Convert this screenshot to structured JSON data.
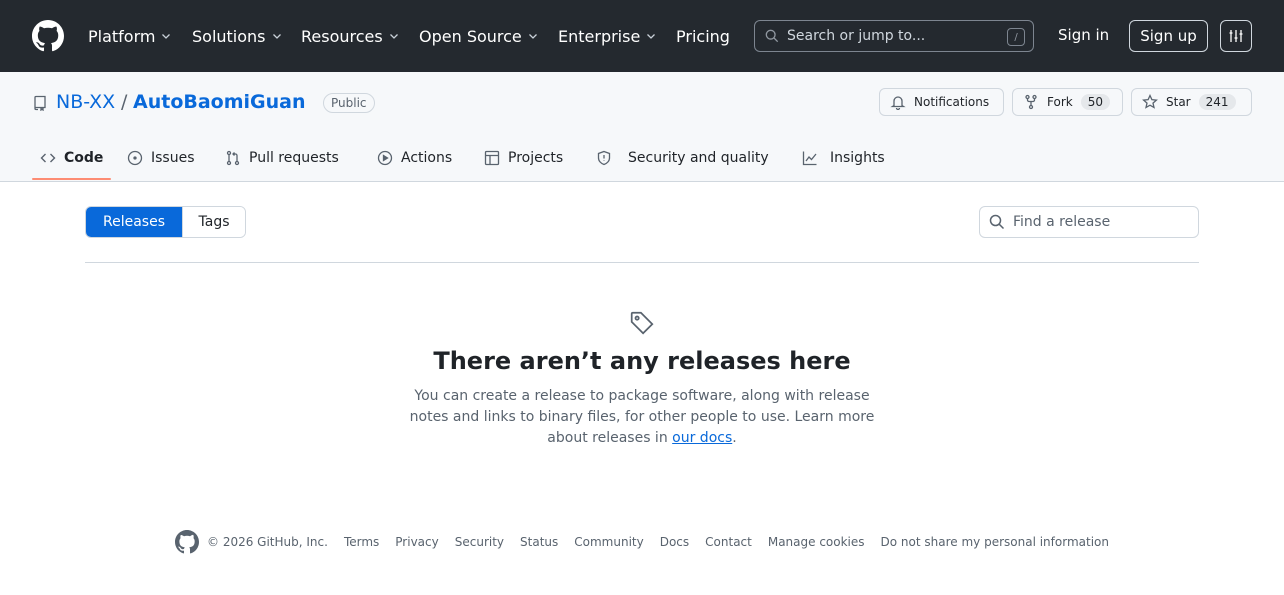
{
  "header": {
    "nav": [
      {
        "label": "Platform",
        "has_menu": true
      },
      {
        "label": "Solutions",
        "has_menu": true
      },
      {
        "label": "Resources",
        "has_menu": true
      },
      {
        "label": "Open Source",
        "has_menu": true
      },
      {
        "label": "Enterprise",
        "has_menu": true
      },
      {
        "label": "Pricing",
        "has_menu": false
      }
    ],
    "search_placeholder": "Search or jump to...",
    "search_shortcut": "/",
    "sign_in": "Sign in",
    "sign_up": "Sign up",
    "colors": {
      "background": "#24292f",
      "text": "#ffffff"
    }
  },
  "repo": {
    "owner": "NB-XX",
    "separator": "/",
    "name": "AutoBaomiGuan",
    "visibility": "Public",
    "notifications_label": "Notifications",
    "fork_label": "Fork",
    "fork_count": "50",
    "star_label": "Star",
    "star_count": "241"
  },
  "tabs": [
    {
      "label": "Code",
      "icon": "code-icon",
      "selected": true
    },
    {
      "label": "Issues",
      "icon": "issue-icon",
      "selected": false
    },
    {
      "label": "Pull requests",
      "icon": "pull-request-icon",
      "selected": false
    },
    {
      "label": "Actions",
      "icon": "play-icon",
      "selected": false
    },
    {
      "label": "Projects",
      "icon": "table-icon",
      "selected": false
    },
    {
      "label": "Security and quality",
      "icon": "shield-icon",
      "selected": false
    },
    {
      "label": "Insights",
      "icon": "graph-icon",
      "selected": false
    }
  ],
  "releases": {
    "segments": [
      {
        "label": "Releases",
        "active": true
      },
      {
        "label": "Tags",
        "active": false
      }
    ],
    "find_placeholder": "Find a release",
    "blank_title": "There aren’t any releases here",
    "blank_desc_before": "You can create a release to package software, along with release notes and links to binary files, for other people to use. Learn more about releases in ",
    "blank_desc_link": "our docs",
    "blank_desc_after": ".",
    "accent_color": "#0969da"
  },
  "footer": {
    "copyright": "© 2026 GitHub, Inc.",
    "links": [
      "Terms",
      "Privacy",
      "Security",
      "Status",
      "Community",
      "Docs",
      "Contact",
      "Manage cookies",
      "Do not share my personal information"
    ]
  }
}
